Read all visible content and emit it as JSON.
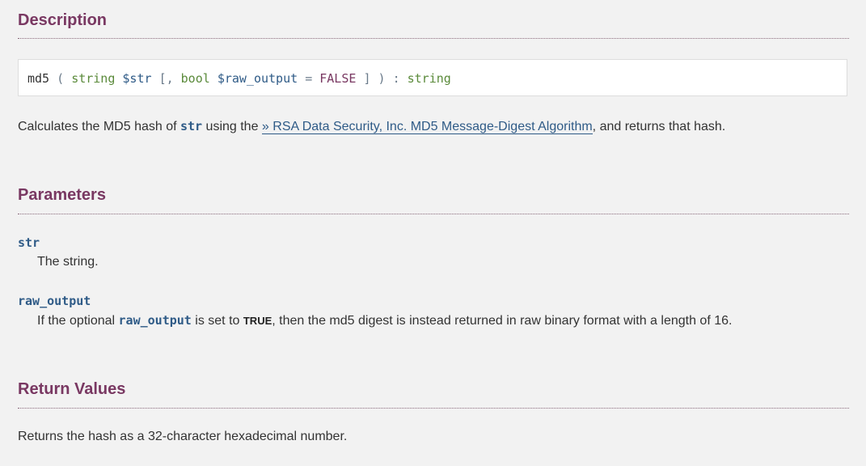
{
  "description": {
    "title": "Description",
    "signature": {
      "func": "md5",
      "open_paren": "(",
      "type1": "string",
      "param1": "$str",
      "optional_open": "[,",
      "type2": "bool",
      "param2": "$raw_output",
      "equals": "=",
      "default": "FALSE",
      "optional_close": "]",
      "close_paren": ")",
      "colon": ":",
      "return_type": "string"
    },
    "text_before": "Calculates the MD5 hash of ",
    "str_code": "str",
    "text_middle": " using the ",
    "link_text": "» RSA Data Security, Inc. MD5 Message-Digest Algorithm",
    "text_after": ", and returns that hash."
  },
  "parameters": {
    "title": "Parameters",
    "items": [
      {
        "name": "str",
        "desc": "The string."
      },
      {
        "name": "raw_output",
        "desc_before": "If the optional ",
        "desc_code": "raw_output",
        "desc_middle": " is set to ",
        "desc_const": "TRUE",
        "desc_after": ", then the md5 digest is instead returned in raw binary format with a length of 16."
      }
    ]
  },
  "return_values": {
    "title": "Return Values",
    "text": "Returns the hash as a 32-character hexadecimal number."
  },
  "colors": {
    "heading": "#793862",
    "code": "#2f5b87",
    "type": "#5a8a3a",
    "background": "#f2f2f2"
  }
}
